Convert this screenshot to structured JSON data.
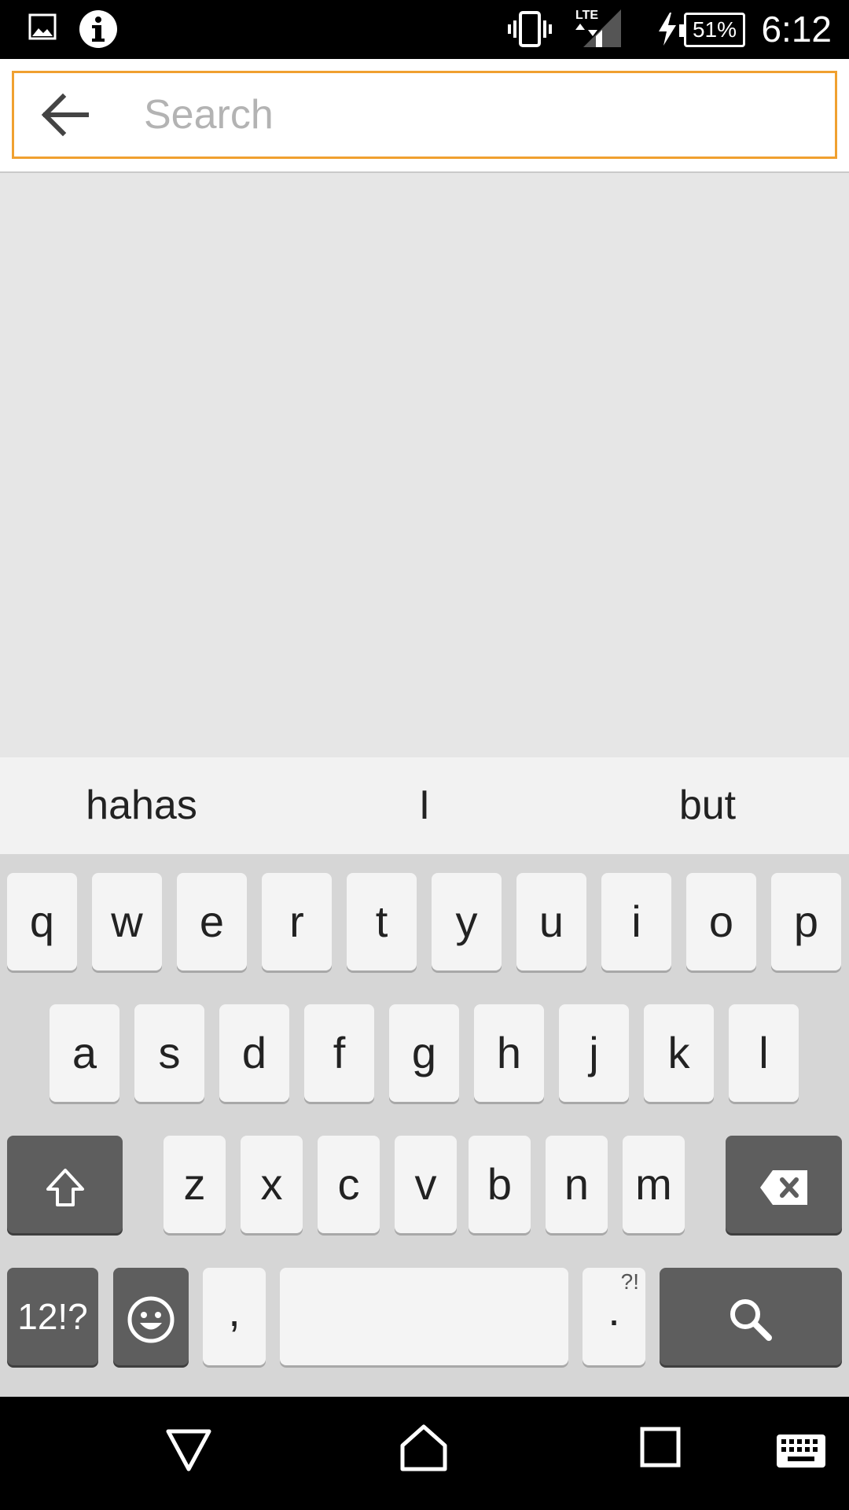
{
  "status_bar": {
    "time": "6:12",
    "battery_percent": "51%",
    "network": "LTE",
    "icons": [
      "image-icon",
      "info-icon",
      "vibrate-icon",
      "lte-signal-icon",
      "charging-icon",
      "battery-icon"
    ]
  },
  "search": {
    "placeholder": "Search",
    "value": "",
    "focus_color": "#f0a030"
  },
  "suggestions": [
    "hahas",
    "I",
    "but"
  ],
  "keyboard": {
    "row1": [
      "q",
      "w",
      "e",
      "r",
      "t",
      "y",
      "u",
      "i",
      "o",
      "p"
    ],
    "row2": [
      "a",
      "s",
      "d",
      "f",
      "g",
      "h",
      "j",
      "k",
      "l"
    ],
    "row3": [
      "z",
      "x",
      "c",
      "v",
      "b",
      "n",
      "m"
    ],
    "symbols_label": "12!?",
    "comma_label": ",",
    "period_label": ".",
    "period_alt": "?!"
  },
  "nav_bar": {
    "icons": [
      "back-triangle-icon",
      "home-icon",
      "recents-icon",
      "keyboard-icon"
    ]
  }
}
